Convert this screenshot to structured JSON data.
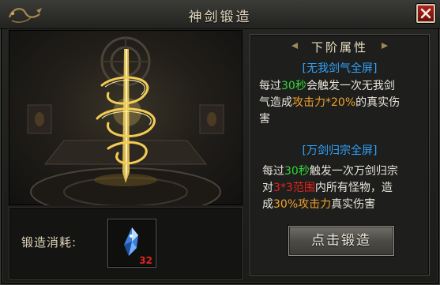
{
  "window": {
    "title": "神剑锻造"
  },
  "info": {
    "heading": "下阶属性",
    "skill1": {
      "name": "[无我剑气全屏]",
      "p1": "每过",
      "time": "30秒",
      "p2": "会触发一次无我剑",
      "p3": "气造成",
      "dmg": "攻击力*20%",
      "p4": "的真实伤",
      "p5": "害"
    },
    "skill2": {
      "name": "[万剑归宗全屏]",
      "p1": "每过",
      "time": "30秒",
      "p2": "触发一次万剑归宗",
      "p3": "对",
      "range": "3*3范围",
      "p4": "内所有怪物，造",
      "p5": "成",
      "dmg": "30%攻击力",
      "p6": "真实伤害"
    }
  },
  "cost": {
    "label": "锻造消耗:",
    "item_icon": "crystal-shard-icon",
    "quantity": "32"
  },
  "forge_button": {
    "label": "点击锻造"
  },
  "colors": {
    "highlight_green": "#36d53a",
    "highlight_orange": "#f0a22c",
    "highlight_red": "#e3231d",
    "skill_blue": "#2fa4ff"
  }
}
